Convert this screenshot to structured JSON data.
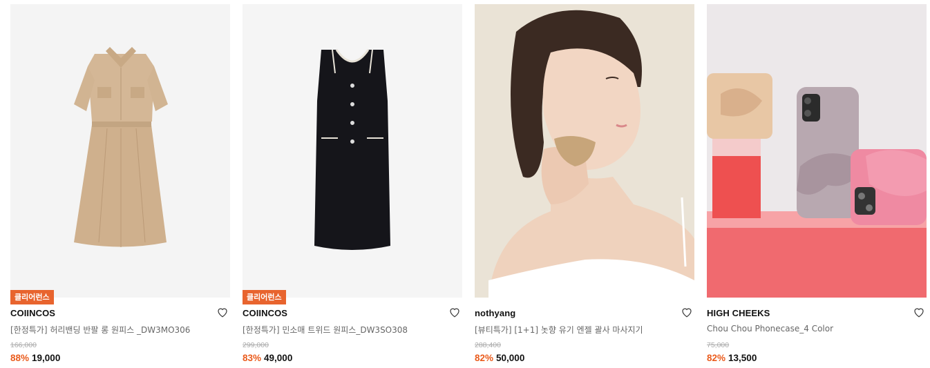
{
  "products": [
    {
      "badge": "클리어런스",
      "brand": "COIINCOS",
      "name": "[한정특가] 허리밴딩 반팔 롱 원피스 _DW3MO306",
      "original_price": "166,000",
      "discount": "88%",
      "price": "19,000",
      "image_icon": "beige-shirt-dress-photo"
    },
    {
      "badge": "클리어런스",
      "brand": "COIINCOS",
      "name": "[한정특가] 민소매 트위드 원피스_DW3SO308",
      "original_price": "299,000",
      "discount": "83%",
      "price": "49,000",
      "image_icon": "black-tweed-dress-photo"
    },
    {
      "badge": "",
      "brand": "nothyang",
      "name": "[뷰티특가] [1+1] 놋향 유기 엔젤 괄사 마사지기",
      "original_price": "288,400",
      "discount": "82%",
      "price": "50,000",
      "image_icon": "model-gua-sha-photo"
    },
    {
      "badge": "",
      "brand": "HIGH CHEEKS",
      "name": "Chou Chou Phonecase_4 Color",
      "original_price": "75,000",
      "discount": "82%",
      "price": "13,500",
      "image_icon": "bow-phonecase-photo"
    }
  ],
  "colors": {
    "accent": "#ea5b1c",
    "badge_bg": "#e8642e"
  }
}
